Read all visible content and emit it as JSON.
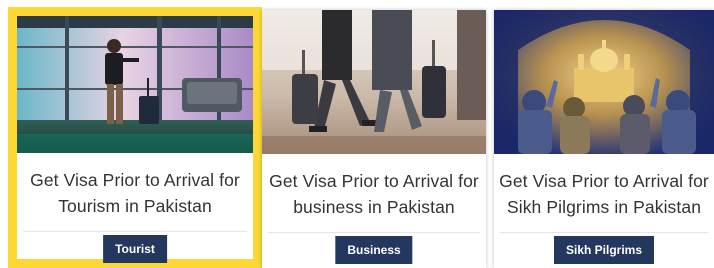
{
  "colors": {
    "highlight_border": "#fdd835",
    "button_bg": "#23375f",
    "button_text": "#ffffff",
    "title_text": "#333333"
  },
  "cards": [
    {
      "image": "traveler-airport-window-photo",
      "title_line1": "Get Visa Prior to Arrival for",
      "title_line2": "Tourism in Pakistan",
      "button": "Tourist",
      "selected": true
    },
    {
      "image": "travelers-with-luggage-photo",
      "title_line1": "Get Visa Prior to Arrival for",
      "title_line2": "business in Pakistan",
      "button": "Business",
      "selected": false
    },
    {
      "image": "sikh-pilgrims-gurdwara-photo",
      "title_line1": "Get Visa Prior to Arrival for",
      "title_line2": "Sikh Pilgrims in Pakistan",
      "button": "Sikh Pilgrims",
      "selected": false
    }
  ]
}
